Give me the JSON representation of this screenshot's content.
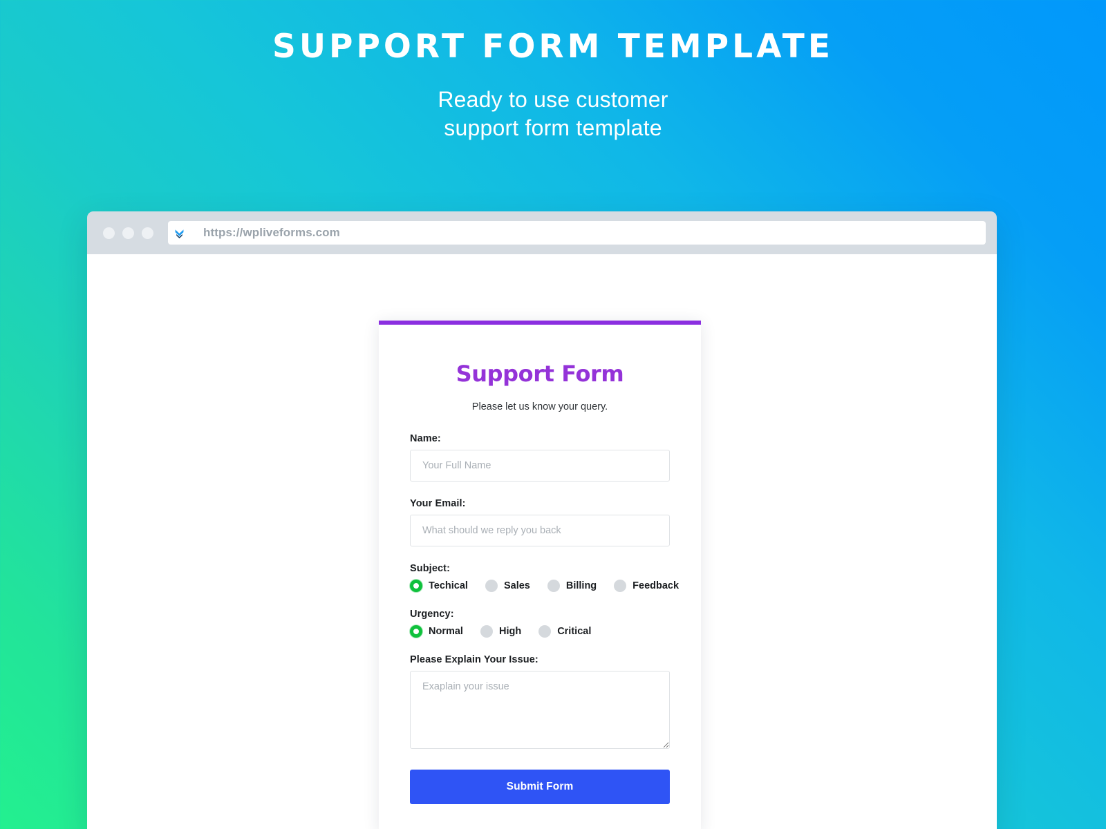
{
  "hero": {
    "title": "Support Form Template",
    "subtitle_line1": "Ready to use customer",
    "subtitle_line2": "support form template"
  },
  "browser": {
    "favicon_name": "chevron-double-down-icon",
    "url": "https://wpliveforms.com"
  },
  "form": {
    "accent_color": "#8b2fe0",
    "title": "Support Form",
    "subtitle": "Please let us know your query.",
    "name_label": "Name:",
    "name_placeholder": "Your Full Name",
    "name_value": "",
    "email_label": "Your Email:",
    "email_placeholder": "What should we reply you back",
    "email_value": "",
    "subject_label": "Subject:",
    "subject_options": [
      {
        "label": "Techical",
        "selected": true
      },
      {
        "label": "Sales",
        "selected": false
      },
      {
        "label": "Billing",
        "selected": false
      },
      {
        "label": "Feedback",
        "selected": false
      }
    ],
    "urgency_label": "Urgency:",
    "urgency_options": [
      {
        "label": "Normal",
        "selected": true
      },
      {
        "label": "High",
        "selected": false
      },
      {
        "label": "Critical",
        "selected": false
      }
    ],
    "issue_label": "Please Explain Your Issue:",
    "issue_placeholder": "Exaplain your issue",
    "issue_value": "",
    "submit_label": "Submit Form",
    "submit_color": "#2f54f5",
    "selected_radio_color": "#0fc13c"
  }
}
